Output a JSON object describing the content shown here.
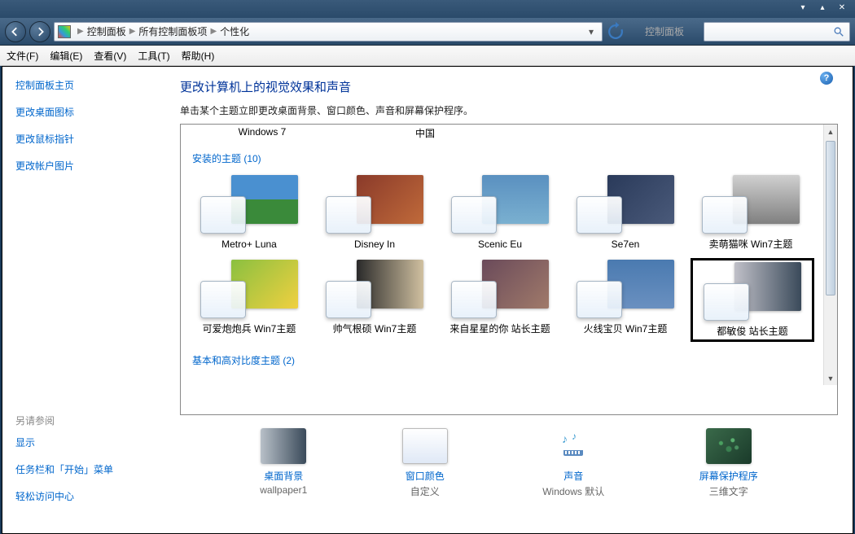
{
  "titlebar": {
    "text": "控制面板"
  },
  "breadcrumb": {
    "items": [
      "控制面板",
      "所有控制面板项",
      "个性化"
    ]
  },
  "menubar": {
    "file": "文件(F)",
    "edit": "编辑(E)",
    "view": "查看(V)",
    "tools": "工具(T)",
    "help": "帮助(H)"
  },
  "sidebar": {
    "home": "控制面板主页",
    "desktop_icons": "更改桌面图标",
    "mouse_pointers": "更改鼠标指针",
    "account_picture": "更改帐户图片",
    "see_also": "另请参阅",
    "display": "显示",
    "taskbar": "任务栏和「开始」菜单",
    "ease": "轻松访问中心"
  },
  "main": {
    "title": "更改计算机上的视觉效果和声音",
    "desc": "单击某个主题立即更改桌面背景、窗口颜色、声音和屏幕保护程序。",
    "header1": "Windows 7",
    "header2": "中国",
    "installed_section": "安装的主题 (10)",
    "basic_section": "基本和高对比度主题 (2)",
    "themes": [
      {
        "label": "Metro+ Luna",
        "bg": "linear-gradient(to bottom, #4a90d0 50%, #3a8a3a 50%)",
        "stack": false
      },
      {
        "label": "Disney In",
        "bg": "linear-gradient(135deg, #8a3a2a, #c06a3a)",
        "stack": true
      },
      {
        "label": "Scenic Eu",
        "bg": "linear-gradient(to bottom, #5a90c0, #7ab0d0)",
        "stack": true
      },
      {
        "label": "Se7en",
        "bg": "linear-gradient(135deg, #2a3a5a, #4a5a7a)",
        "stack": true
      },
      {
        "label": "卖萌猫咪 Win7主题",
        "bg": "linear-gradient(to bottom, #d0d0d0, #808080)",
        "stack": true
      },
      {
        "label": "可爱炮炮兵 Win7主题",
        "bg": "linear-gradient(135deg, #8ac040, #f0d040)",
        "stack": true
      },
      {
        "label": "帅气根硕 Win7主题",
        "bg": "linear-gradient(to right, #2a2a2a, #d0c0a0)",
        "stack": true
      },
      {
        "label": "来自星星的你 站长主题",
        "bg": "linear-gradient(135deg, #6a4a5a, #a07a6a)",
        "stack": true
      },
      {
        "label": "火线宝贝 Win7主题",
        "bg": "linear-gradient(to bottom, #4a7ab0, #6a90c0)",
        "stack": true
      },
      {
        "label": "都敏俊 站长主题",
        "bg": "linear-gradient(to right, #c0c0c8, #3a4a5a)",
        "stack": true,
        "selected": true
      }
    ]
  },
  "bottom": {
    "bg": {
      "title": "桌面背景",
      "sub": "wallpaper1"
    },
    "color": {
      "title": "窗口颜色",
      "sub": "自定义"
    },
    "sound": {
      "title": "声音",
      "sub": "Windows 默认"
    },
    "saver": {
      "title": "屏幕保护程序",
      "sub": "三维文字"
    }
  }
}
